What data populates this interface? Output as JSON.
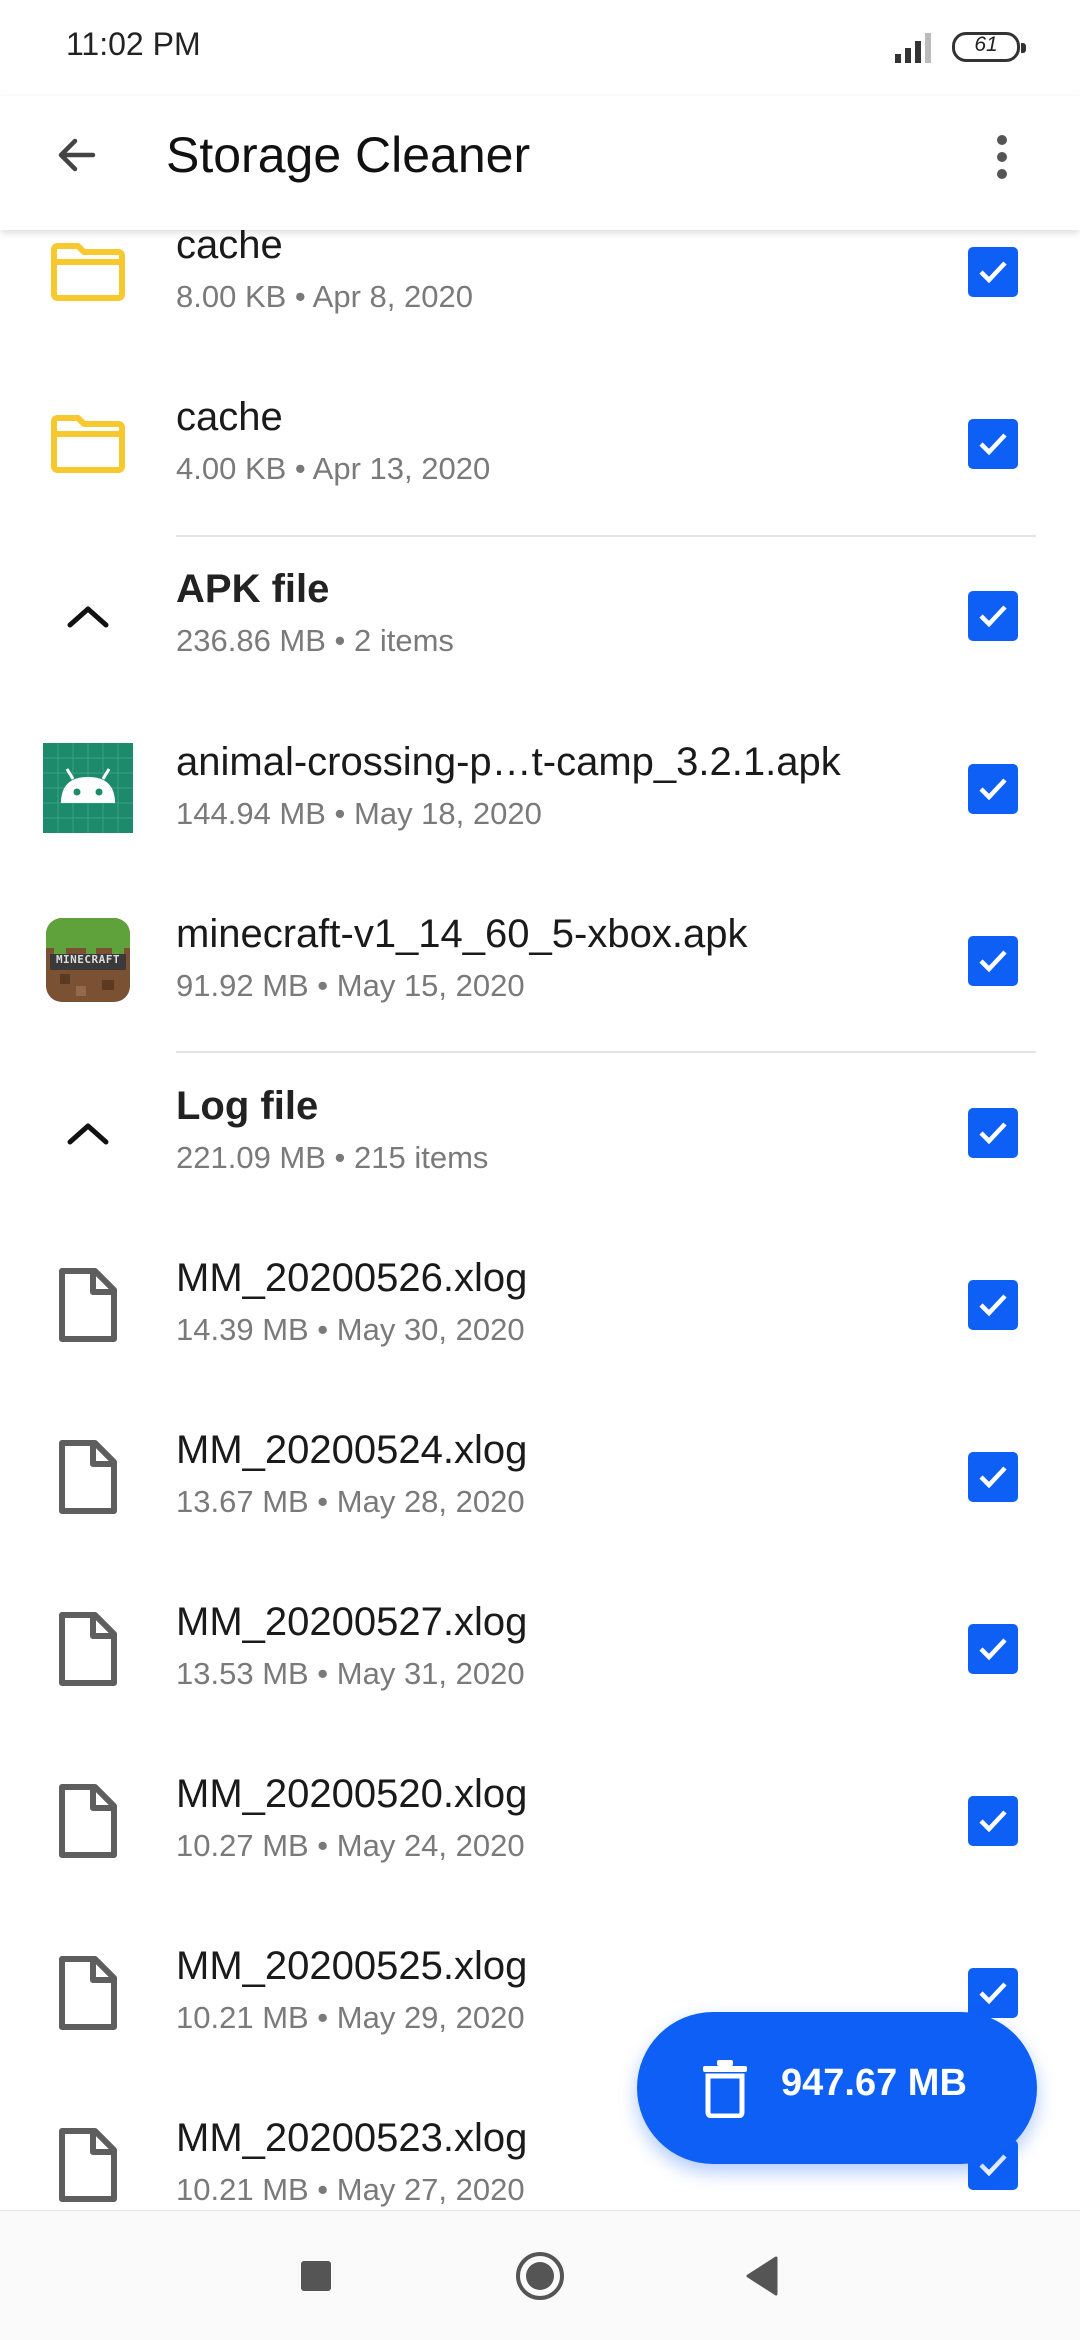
{
  "status_bar": {
    "time": "11:02 PM",
    "battery": "61"
  },
  "app_bar": {
    "title": "Storage Cleaner"
  },
  "items": [
    {
      "kind": "folder",
      "title": "cache",
      "subtitle": "8.00 KB • Apr 8, 2020",
      "checked": true
    },
    {
      "kind": "folder",
      "title": "cache",
      "subtitle": "4.00 KB • Apr 13, 2020",
      "checked": true
    },
    {
      "kind": "group",
      "title": "APK file",
      "subtitle": "236.86 MB • 2 items",
      "checked": true
    },
    {
      "kind": "apk-android",
      "title": "animal-crossing-p…t-camp_3.2.1.apk",
      "subtitle": "144.94 MB • May 18, 2020",
      "checked": true
    },
    {
      "kind": "apk-minecraft",
      "title": "minecraft-v1_14_60_5-xbox.apk",
      "subtitle": "91.92 MB • May 15, 2020",
      "checked": true,
      "icon_text": "MINECRAFT"
    },
    {
      "kind": "group",
      "title": "Log file",
      "subtitle": "221.09 MB • 215 items",
      "checked": true
    },
    {
      "kind": "file",
      "title": "MM_20200526.xlog",
      "subtitle": "14.39 MB • May 30, 2020",
      "checked": true
    },
    {
      "kind": "file",
      "title": "MM_20200524.xlog",
      "subtitle": "13.67 MB • May 28, 2020",
      "checked": true
    },
    {
      "kind": "file",
      "title": "MM_20200527.xlog",
      "subtitle": "13.53 MB • May 31, 2020",
      "checked": true
    },
    {
      "kind": "file",
      "title": "MM_20200520.xlog",
      "subtitle": "10.27 MB • May 24, 2020",
      "checked": true
    },
    {
      "kind": "file",
      "title": "MM_20200525.xlog",
      "subtitle": "10.21 MB • May 29, 2020",
      "checked": true
    },
    {
      "kind": "file",
      "title": "MM_20200523.xlog",
      "subtitle": "10.21 MB • May 27, 2020",
      "checked": true
    }
  ],
  "fab": {
    "label": "947.67 MB"
  },
  "colors": {
    "accent": "#0d5ff5",
    "folder": "#f8c92f",
    "android_tile": "#1e8a6c"
  }
}
